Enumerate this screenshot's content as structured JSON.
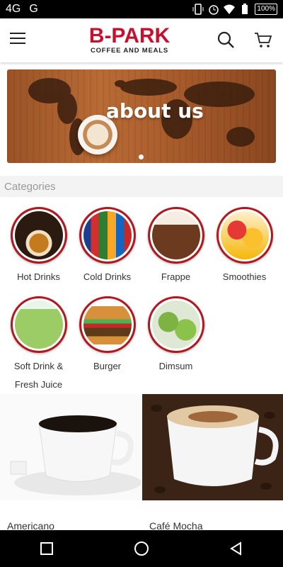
{
  "status_bar": {
    "network_left": "4G",
    "network_right": "G",
    "battery": "100%"
  },
  "app_bar": {
    "logo_title": "B-PARK",
    "logo_subtitle": "COFFEE AND MEALS"
  },
  "banner": {
    "title": "about us"
  },
  "categories": {
    "title": "Categories",
    "items": [
      {
        "label": "Hot Drinks"
      },
      {
        "label": "Cold Drinks"
      },
      {
        "label": "Frappe"
      },
      {
        "label": "Smoothies"
      },
      {
        "label": "Soft Drink &\nFresh Juice"
      },
      {
        "label": "Burger"
      },
      {
        "label": "Dimsum"
      }
    ]
  },
  "products": [
    {
      "name": "Americano"
    },
    {
      "name": "Café Mocha"
    }
  ],
  "colors": {
    "brand_red": "#c8102e",
    "circle_border": "#b0171f"
  }
}
